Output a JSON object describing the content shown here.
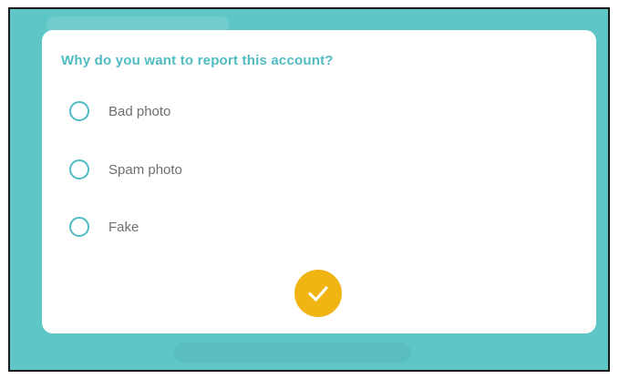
{
  "dialog": {
    "title": "Why do you want to report this account?",
    "options": [
      {
        "label": "Bad photo",
        "selected": false
      },
      {
        "label": "Spam photo",
        "selected": false
      },
      {
        "label": "Fake",
        "selected": false
      }
    ],
    "confirm_icon": "checkmark-icon"
  },
  "colors": {
    "background": "#5ec6c6",
    "accent": "#4fbcc2",
    "confirm": "#f0b413",
    "option_text": "#6f6f6f"
  }
}
